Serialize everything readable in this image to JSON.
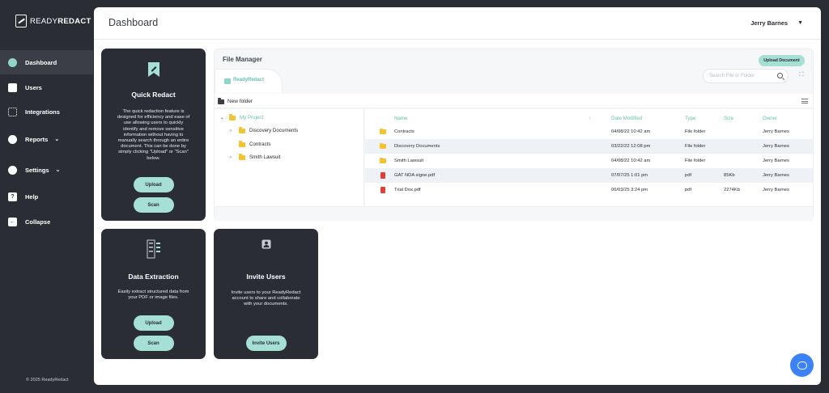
{
  "app": {
    "logo_ready": "READY",
    "logo_redact": "REDACT"
  },
  "sidebar": {
    "items": [
      {
        "label": "Dashboard",
        "icon": "dashboard-icon"
      },
      {
        "label": "Users",
        "icon": "user-icon"
      },
      {
        "label": "Integrations",
        "icon": "integrations-icon"
      },
      {
        "label": "Reports",
        "icon": "reports-icon"
      },
      {
        "label": "Settings",
        "icon": "gear-icon"
      },
      {
        "label": "Help",
        "icon": "help-icon"
      },
      {
        "label": "Collapse",
        "icon": "collapse-icon"
      }
    ],
    "copyright": "© 2025 ReadyRedact"
  },
  "header": {
    "title": "Dashboard",
    "user_name": "Jerry Barnes"
  },
  "cards": {
    "quick_redact": {
      "title": "Quick Redact",
      "description": "The quick redaction feature is designed for efficiency and ease of use allowing users to quickly identify and remove sensitive information without having to manually search through an entire document. This can be done by simply clicking \"Upload\" or \"Scan\" below.",
      "upload": "Upload",
      "scan": "Scan"
    },
    "data_extraction": {
      "title": "Data Extraction",
      "description": "Easily extract structured data from your PDF or image files.",
      "upload": "Upload",
      "scan": "Scan"
    },
    "invite_users": {
      "title": "Invite Users",
      "description": "Invite users to your ReadyRedact account to share and collaborate with your documents.",
      "button": "Invite Users"
    }
  },
  "file_manager": {
    "title": "File Manager",
    "upload_button": "Upload Document",
    "tab_label": "ReadyRedact",
    "search_placeholder": "Search File or Folder",
    "new_folder": "New folder",
    "tree": [
      {
        "label": "My Project"
      },
      {
        "label": "Discovery Documents"
      },
      {
        "label": "Contracts"
      },
      {
        "label": "Smith Lawsuit"
      }
    ],
    "columns": {
      "name": "Name",
      "sort": "↑",
      "date": "Date Modified",
      "type": "Type",
      "size": "Size",
      "owner": "Owner"
    },
    "rows": [
      {
        "name": "Contracts",
        "date": "04/08/22 10:42 am",
        "type": "File folder",
        "size": "",
        "owner": "Jerry Barnes",
        "kind": "folder"
      },
      {
        "name": "Discovery Documents",
        "date": "03/22/22 12:08 pm",
        "type": "File folder",
        "size": "",
        "owner": "Jerry Barnes",
        "kind": "folder"
      },
      {
        "name": "Smith Lawsuit",
        "date": "04/08/22 10:42 am",
        "type": "File folder",
        "size": "",
        "owner": "Jerry Barnes",
        "kind": "folder"
      },
      {
        "name": "GAT NDA signe.pdf",
        "date": "07/07/25 1:01 pm",
        "type": "pdf",
        "size": "85Kb",
        "owner": "Jerry Barnes",
        "kind": "pdf"
      },
      {
        "name": "Trial Dox.pdf",
        "date": "06/03/25 3:24 pm",
        "type": "pdf",
        "size": "2274Kb",
        "owner": "Jerry Barnes",
        "kind": "pdf"
      }
    ]
  },
  "colors": {
    "accent": "#a6dfd3",
    "sidebar_bg": "#2b2d35",
    "help_bubble": "#3b82f6"
  }
}
